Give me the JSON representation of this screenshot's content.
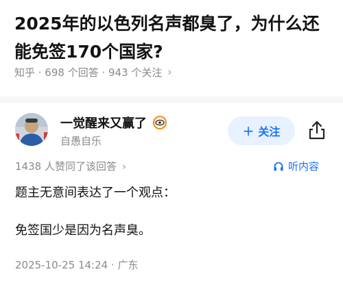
{
  "question": {
    "title": "2025年的以色列名声都臭了，为什么还能免签170个国家?",
    "meta": "知乎 · 698 个回答 · 943 个关注",
    "chevron": "›"
  },
  "author": {
    "name": "一觉醒来又赢了",
    "bio": "自愚自乐",
    "avatar_icon": "user-avatar-photo",
    "badge_icon": "eye-badge-icon",
    "follow_label": "关注",
    "follow_plus": "+",
    "share_icon": "share-icon"
  },
  "answer": {
    "vote_summary": "1438 人赞同了该回答",
    "chevron": "›",
    "listen_label": "听内容",
    "paragraphs": [
      "题主无意间表达了一个观点：",
      "免签国少是因为名声臭。"
    ],
    "time": "2025-10-25 14:24 · 广东"
  },
  "colors": {
    "accent": "#1772f6",
    "follow_bg": "#e8f1ff",
    "muted": "#8a8a8a",
    "badge": "#f08a24"
  }
}
